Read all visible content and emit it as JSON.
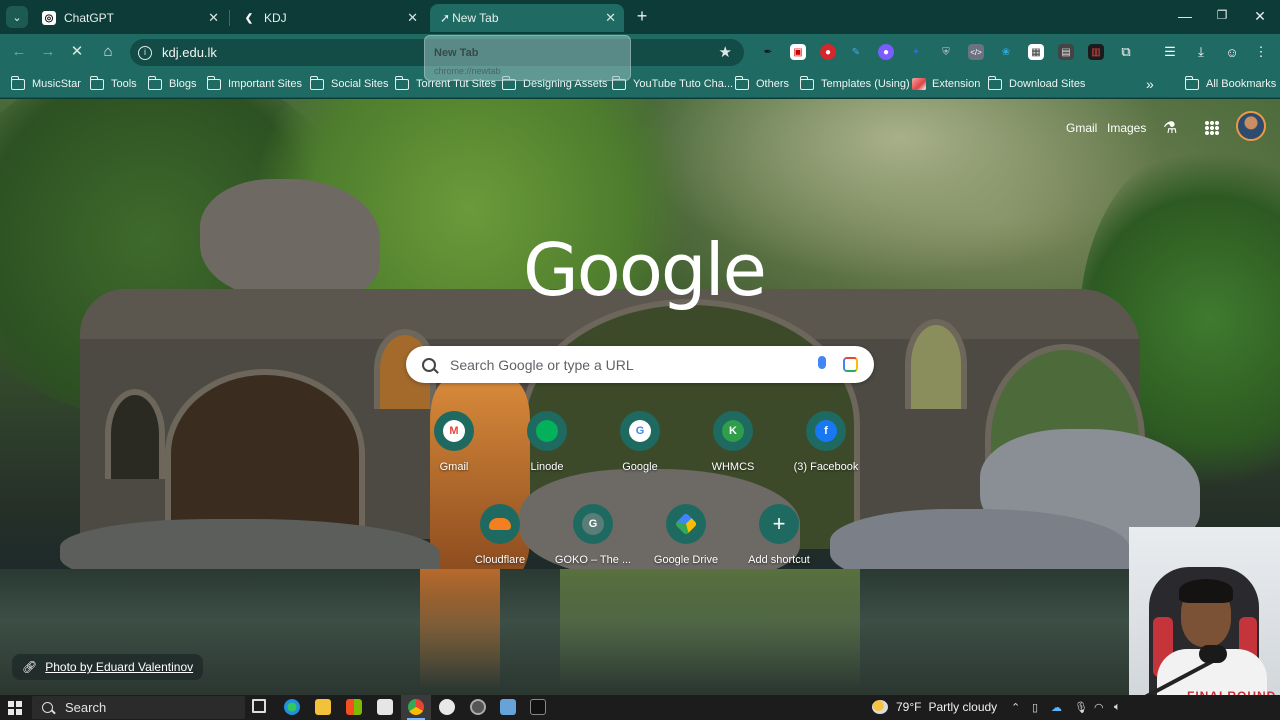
{
  "tabs": [
    {
      "title": "ChatGPT",
      "active": false
    },
    {
      "title": "KDJ",
      "active": false
    },
    {
      "title": "New Tab",
      "active": true
    }
  ],
  "tooltip": {
    "title": "New Tab",
    "url": "chrome://newtab"
  },
  "omnibox": {
    "url": "kdj.edu.lk"
  },
  "bookmarks": [
    {
      "label": "MusicStar",
      "type": "folder"
    },
    {
      "label": "Tools",
      "type": "folder"
    },
    {
      "label": "Blogs",
      "type": "folder"
    },
    {
      "label": "Important Sites",
      "type": "folder"
    },
    {
      "label": "Social Sites",
      "type": "folder"
    },
    {
      "label": "Torrent Tut Sites",
      "type": "folder"
    },
    {
      "label": "Designing Assets",
      "type": "folder"
    },
    {
      "label": "YouTube Tuto Cha...",
      "type": "folder"
    },
    {
      "label": "Others",
      "type": "folder"
    },
    {
      "label": "Templates (Using)",
      "type": "folder"
    },
    {
      "label": "Extension",
      "type": "page"
    },
    {
      "label": "Download Sites",
      "type": "folder"
    }
  ],
  "all_bookmarks": "All Bookmarks",
  "ntp": {
    "gmail": "Gmail",
    "images": "Images",
    "logo": "Google",
    "search_placeholder": "Search Google or type a URL",
    "shortcuts": [
      {
        "label": "Gmail",
        "letter": "M",
        "color": "#ea4335"
      },
      {
        "label": "Linode",
        "letter": "",
        "color": "#02b159"
      },
      {
        "label": "Google",
        "letter": "G",
        "color": "#4285f4"
      },
      {
        "label": "WHMCS",
        "letter": "K",
        "color": "#2e9e4a"
      },
      {
        "label": "(3) Facebook",
        "letter": "f",
        "color": "#1877f2"
      },
      {
        "label": "Cloudflare",
        "letter": "",
        "color": "#f38020"
      },
      {
        "label": "GOKO – The ...",
        "letter": "G",
        "color": "#5a7d77"
      },
      {
        "label": "Google Drive",
        "letter": "",
        "color": "#34a853"
      },
      {
        "label": "Add shortcut",
        "letter": "+",
        "color": "#ffffff"
      }
    ],
    "photo_credit": "Photo by Eduard Valentinov"
  },
  "webcam": {
    "shirt_text": "FINALROUND"
  },
  "taskbar": {
    "search_label": "Search",
    "weather_temp": "79°F",
    "weather_desc": "Partly cloudy"
  }
}
